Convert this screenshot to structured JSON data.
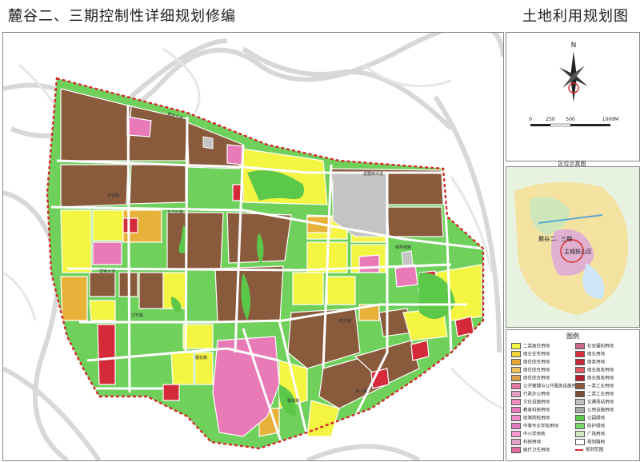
{
  "header": {
    "title_left": "麓谷二、三期控制性详细规划修编",
    "title_right": "土地利用规划图"
  },
  "compass": {
    "north_label": "N",
    "scale_ticks": [
      "0",
      "250",
      "500",
      "1000M"
    ]
  },
  "location_map": {
    "title": "区位示意图",
    "labels": [
      "麓谷二、三期",
      "主城核心区"
    ]
  },
  "legend": {
    "title": "图例",
    "left_column": [
      {
        "label": "二类居住用地",
        "color": "#f4f442"
      },
      {
        "label": "商业住宅用地",
        "color": "#f2d53c"
      },
      {
        "label": "商住综合用地",
        "color": "#e8a93a"
      },
      {
        "label": "商住综合用地",
        "color": "#f0c060"
      },
      {
        "label": "商住综合用地",
        "color": "#d9a050"
      },
      {
        "label": "公共管理与公共服务设施用地",
        "color": "#e07aa0"
      },
      {
        "label": "行政办公用地",
        "color": "#e2a0c0"
      },
      {
        "label": "文化设施用地",
        "color": "#eb8fc0"
      },
      {
        "label": "教育科研用地",
        "color": "#e87ab8"
      },
      {
        "label": "高等院校用地",
        "color": "#f08ac8"
      },
      {
        "label": "中等专业学校用地",
        "color": "#e17cc0"
      },
      {
        "label": "中小学用地",
        "color": "#f29cd0"
      },
      {
        "label": "科研用地",
        "color": "#e0a4c8"
      },
      {
        "label": "医疗卫生用地",
        "color": "#e06aa0"
      }
    ],
    "right_column": [
      {
        "label": "社会福利用地",
        "color": "#c96a8a"
      },
      {
        "label": "商业用地",
        "color": "#d93040"
      },
      {
        "label": "商务用地",
        "color": "#c42a3a"
      },
      {
        "label": "商业商务用地",
        "color": "#e25a60"
      },
      {
        "label": "商业商务用地",
        "color": "#b82030"
      },
      {
        "label": "一类工业用地",
        "color": "#8a5a3c"
      },
      {
        "label": "二类工业用地",
        "color": "#7a4e34"
      },
      {
        "label": "交通场站用地",
        "color": "#c0c0c0"
      },
      {
        "label": "公用设施用地",
        "color": "#a8a8a8"
      },
      {
        "label": "公园绿地",
        "color": "#5cc84a"
      },
      {
        "label": "防护绿地",
        "color": "#7ad86a"
      },
      {
        "label": "广场用地",
        "color": "#d0e8c0"
      },
      {
        "label": "规划路网",
        "color": "#ffffff"
      },
      {
        "label": "规划范围",
        "color": "#d42a2a"
      }
    ]
  },
  "road_labels": [
    "麓谷大道",
    "东方红路",
    "雷锋大道",
    "岳麓西大道",
    "文轩路",
    "麓松路",
    "林语路",
    "旺龙路",
    "桐梓坡路",
    "麓景路",
    "青山路"
  ],
  "colors": {
    "industrial": "#8a5a3c",
    "residential": "#f4f442",
    "commercial_res": "#e8b83a",
    "green": "#5cc84a",
    "pink": "#e87ab8",
    "red": "#d42a3a",
    "gray": "#c0c0c0",
    "boundary": "#d42a2a"
  }
}
